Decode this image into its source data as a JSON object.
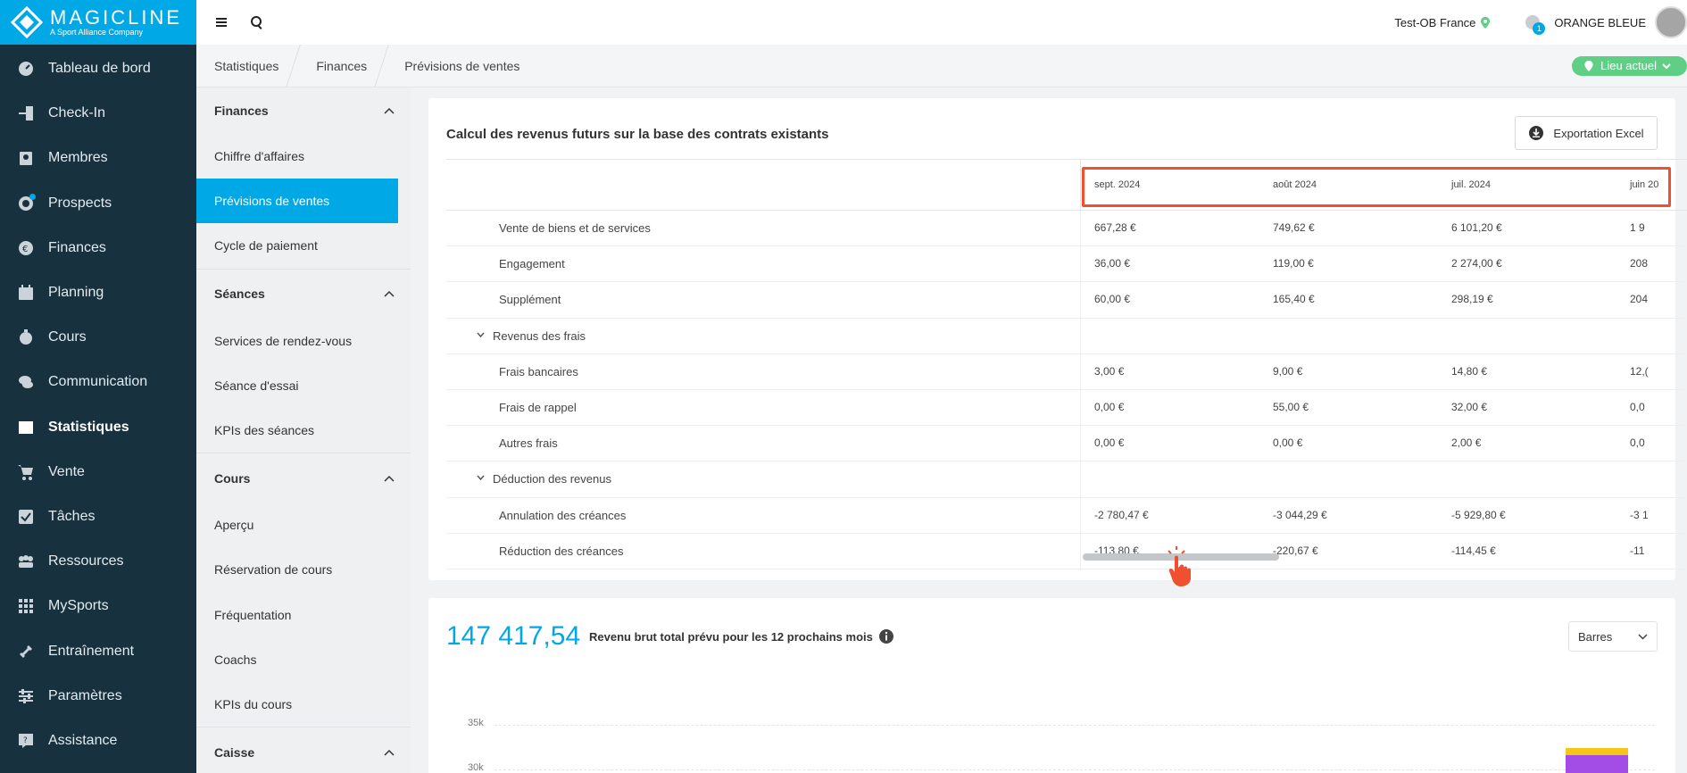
{
  "brand": {
    "name": "MAGICLINE",
    "tagline": "A Sport Alliance Company",
    "accent": "#01a8e6"
  },
  "sidebar": {
    "items": [
      {
        "label": "Tableau de bord",
        "icon": "dashboard-icon"
      },
      {
        "label": "Check-In",
        "icon": "checkin-icon"
      },
      {
        "label": "Membres",
        "icon": "members-icon"
      },
      {
        "label": "Prospects",
        "icon": "prospects-icon"
      },
      {
        "label": "Finances",
        "icon": "euro-icon"
      },
      {
        "label": "Planning",
        "icon": "calendar-icon"
      },
      {
        "label": "Cours",
        "icon": "timer-icon"
      },
      {
        "label": "Communication",
        "icon": "chat-icon"
      },
      {
        "label": "Statistiques",
        "icon": "chart-icon"
      },
      {
        "label": "Vente",
        "icon": "cart-icon"
      },
      {
        "label": "Tâches",
        "icon": "check-icon"
      },
      {
        "label": "Ressources",
        "icon": "resources-icon"
      },
      {
        "label": "MySports",
        "icon": "grid-icon"
      },
      {
        "label": "Entraînement",
        "icon": "dumbbell-icon"
      },
      {
        "label": "Paramètres",
        "icon": "sliders-icon"
      },
      {
        "label": "Assistance",
        "icon": "help-icon"
      }
    ]
  },
  "topbar": {
    "location": "Test-OB France",
    "user": "ORANGE BLEUE",
    "notifications": "1"
  },
  "breadcrumb": [
    "Statistiques",
    "Finances",
    "Prévisions de ventes"
  ],
  "lieu_button": "Lieu actuel",
  "subnav": {
    "finances": {
      "title": "Finances",
      "items": [
        "Chiffre d'affaires",
        "Prévisions de ventes",
        "Cycle de paiement"
      ]
    },
    "seances": {
      "title": "Séances",
      "items": [
        "Services de rendez-vous",
        "Séance d'essai",
        "KPIs des séances"
      ]
    },
    "cours": {
      "title": "Cours",
      "items": [
        "Aperçu",
        "Réservation de cours",
        "Fréquentation",
        "Coachs",
        "KPIs du cours"
      ]
    },
    "caisse": {
      "title": "Caisse"
    }
  },
  "table": {
    "title": "Calcul des revenus futurs sur la base des contrats existants",
    "export_label": "Exportation Excel",
    "months": [
      "sept. 2024",
      "août 2024",
      "juil. 2024",
      "juin 20"
    ],
    "rows": [
      {
        "label": "Vente de biens et de services",
        "values": [
          "667,28 €",
          "749,62 €",
          "6 101,20 €",
          "1 9"
        ]
      },
      {
        "label": "Engagement",
        "values": [
          "36,00 €",
          "119,00 €",
          "2 274,00 €",
          "208"
        ]
      },
      {
        "label": "Supplément",
        "values": [
          "60,00 €",
          "165,40 €",
          "298,19 €",
          "204"
        ]
      },
      {
        "label": "Revenus des frais",
        "group": true,
        "values": [
          "",
          "",
          "",
          ""
        ]
      },
      {
        "label": "Frais bancaires",
        "values": [
          "3,00 €",
          "9,00 €",
          "14,80 €",
          "12,("
        ]
      },
      {
        "label": "Frais de rappel",
        "values": [
          "0,00 €",
          "55,00 €",
          "32,00 €",
          "0,0"
        ]
      },
      {
        "label": "Autres frais",
        "values": [
          "0,00 €",
          "0,00 €",
          "2,00 €",
          "0,0"
        ]
      },
      {
        "label": "Déduction des revenus",
        "group": true,
        "values": [
          "",
          "",
          "",
          ""
        ]
      },
      {
        "label": "Annulation des créances",
        "values": [
          "-2 780,47 €",
          "-3 044,29 €",
          "-5 929,80 €",
          "-3 1"
        ]
      },
      {
        "label": "Réduction des créances",
        "values": [
          "-113,80 €",
          "-220,67 €",
          "-114,45 €",
          "-11"
        ]
      }
    ]
  },
  "forecast": {
    "total": "147 417,54",
    "label": "Revenu brut total prévu pour les 12 prochains mois",
    "view_select": "Barres",
    "ticks": [
      "35k",
      "30k"
    ]
  },
  "colors": {
    "highlight": "#f0502e",
    "lieu": "#5fcf86",
    "bar_purple": "#a34de6",
    "bar_yellow": "#f5c518"
  }
}
